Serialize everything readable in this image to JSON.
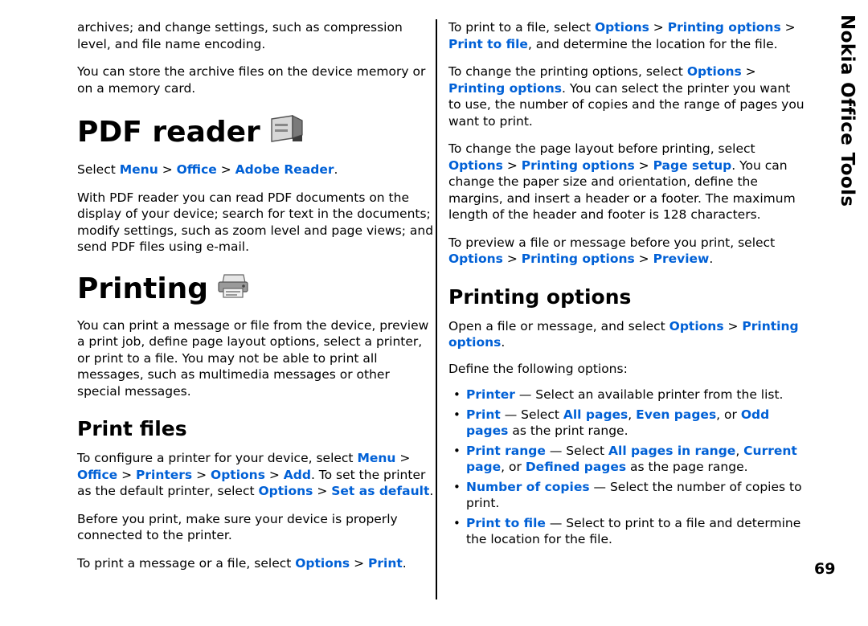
{
  "document": {
    "side_tab": "Nokia Office Tools",
    "page_number": "69"
  },
  "left_column": {
    "intro_para_1": "archives; and change settings, such as compression level, and file name encoding.",
    "intro_para_2": "You can store the archive files on the device memory or on a memory card.",
    "pdf_reader": {
      "heading": "PDF reader",
      "icon": "pdf-reader-icon",
      "select_line": {
        "lead": "Select ",
        "link1": "Menu",
        "sep1": " > ",
        "link2": "Office",
        "sep2": " > ",
        "link3": "Adobe Reader",
        "end": "."
      },
      "description": "With PDF reader you can read PDF documents on the display of your device; search for text in the documents; modify settings, such as zoom level and page views; and send PDF files using e-mail."
    },
    "printing": {
      "heading": "Printing",
      "icon": "printer-icon",
      "description": "You can print a message or file from the device, preview a print job, define page layout options, select a printer, or print to a file. You may not be able to print all messages, such as multimedia messages or other special messages."
    },
    "print_files": {
      "heading": "Print files",
      "configure": {
        "lead": "To configure a printer for your device, select ",
        "l1": "Menu",
        "s1": " > ",
        "l2": "Office",
        "s2": " > ",
        "l3": "Printers",
        "s3": " > ",
        "l4": "Options",
        "s4": " > ",
        "l5": "Add",
        "mid": ". To set the printer as the default printer, select ",
        "l6": "Options",
        "s6": " > ",
        "l7": "Set as default",
        "end": "."
      },
      "before_print": "Before you print, make sure your device is properly connected to the printer.",
      "print_message": {
        "lead": "To print a message or a file, select ",
        "l1": "Options",
        "s1": " > ",
        "l2": "Print",
        "end": "."
      }
    }
  },
  "right_column": {
    "print_to_file": {
      "lead": "To print to a file, select ",
      "l1": "Options",
      "s1": " > ",
      "l2": "Printing options",
      "s2": " > ",
      "l3": "Print to file",
      "end": ", and determine the location for the file."
    },
    "change_printing_options": {
      "lead": "To change the printing options, select ",
      "l1": "Options",
      "s1": " > ",
      "l2": "Printing options",
      "end": ". You can select the printer you want to use, the number of copies and the range of pages you want to print."
    },
    "change_page_layout": {
      "lead": "To change the page layout before printing, select ",
      "l1": "Options",
      "s1": " > ",
      "l2": "Printing options",
      "s2": " > ",
      "l3": "Page setup",
      "end": ". You can change the paper size and orientation, define the margins, and insert a header or a footer. The maximum length of the header and footer is 128 characters."
    },
    "preview": {
      "lead": "To preview a file or message before you print, select ",
      "l1": "Options",
      "s1": " > ",
      "l2": "Printing options",
      "s2": " > ",
      "l3": "Preview",
      "end": "."
    },
    "printing_options": {
      "heading": "Printing options",
      "open_line": {
        "lead": "Open a file or message, and select ",
        "l1": "Options",
        "s1": " > ",
        "l2": "Printing options",
        "end": "."
      },
      "define_line": "Define the following options:",
      "options": [
        {
          "term": "Printer",
          "dash": " — ",
          "rest_before": "Select an available printer from the list.",
          "links": [],
          "rest_after": ""
        },
        {
          "term": "Print",
          "dash": " — ",
          "rest_before": "Select ",
          "links": [
            "All pages",
            "Even pages",
            "Odd pages"
          ],
          "rest_after": " as the print range."
        },
        {
          "term": "Print range",
          "dash": " — ",
          "rest_before": "Select ",
          "links": [
            "All pages in range",
            "Current page",
            "Defined pages"
          ],
          "rest_after": " as the page range."
        },
        {
          "term": "Number of copies",
          "dash": " — ",
          "rest_before": "Select the number of copies to print.",
          "links": [],
          "rest_after": ""
        },
        {
          "term": "Print to file",
          "dash": " — ",
          "rest_before": "Select to print to a file and determine the location for the file.",
          "links": [],
          "rest_after": ""
        }
      ]
    }
  },
  "colors": {
    "link": "#0060d6",
    "text": "#000000",
    "background": "#ffffff"
  }
}
